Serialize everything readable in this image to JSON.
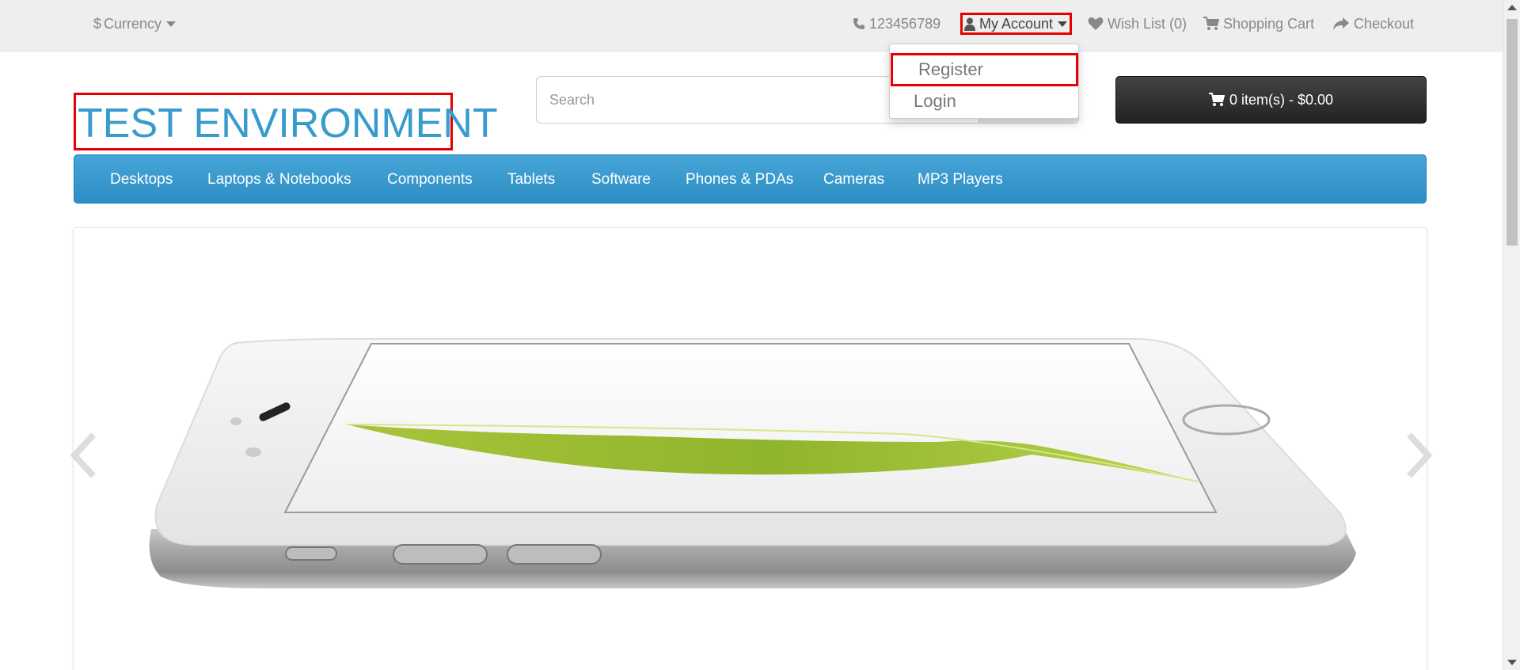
{
  "topbar": {
    "currency_label": "Currency",
    "phone": "123456789",
    "account_label": "My Account",
    "wishlist_label": "Wish List (0)",
    "cart_label": "Shopping Cart",
    "checkout_label": "Checkout",
    "icons": {
      "currency": "dollar-icon",
      "phone": "phone-icon",
      "account": "user-icon",
      "wishlist": "heart-icon",
      "cart": "shopping-cart-icon",
      "checkout": "share-icon"
    }
  },
  "account_dropdown": {
    "items": [
      {
        "label": "Register"
      },
      {
        "label": "Login"
      }
    ]
  },
  "header": {
    "logo_text": "TEST ENVIRONMENT",
    "search_placeholder": "Search",
    "cart_button_label": "0 item(s) - $0.00"
  },
  "menu": {
    "items": [
      {
        "label": "Desktops"
      },
      {
        "label": "Laptops & Notebooks"
      },
      {
        "label": "Components"
      },
      {
        "label": "Tablets"
      },
      {
        "label": "Software"
      },
      {
        "label": "Phones & PDAs"
      },
      {
        "label": "Cameras"
      },
      {
        "label": "MP3 Players"
      }
    ]
  },
  "slideshow": {
    "image_subject": "smartphone with green leaf on screen"
  },
  "colors": {
    "logo": "#389bcd",
    "menu_bar": "#3a9bd0",
    "highlight_box": "#e60000",
    "cart_button": "#333333"
  }
}
